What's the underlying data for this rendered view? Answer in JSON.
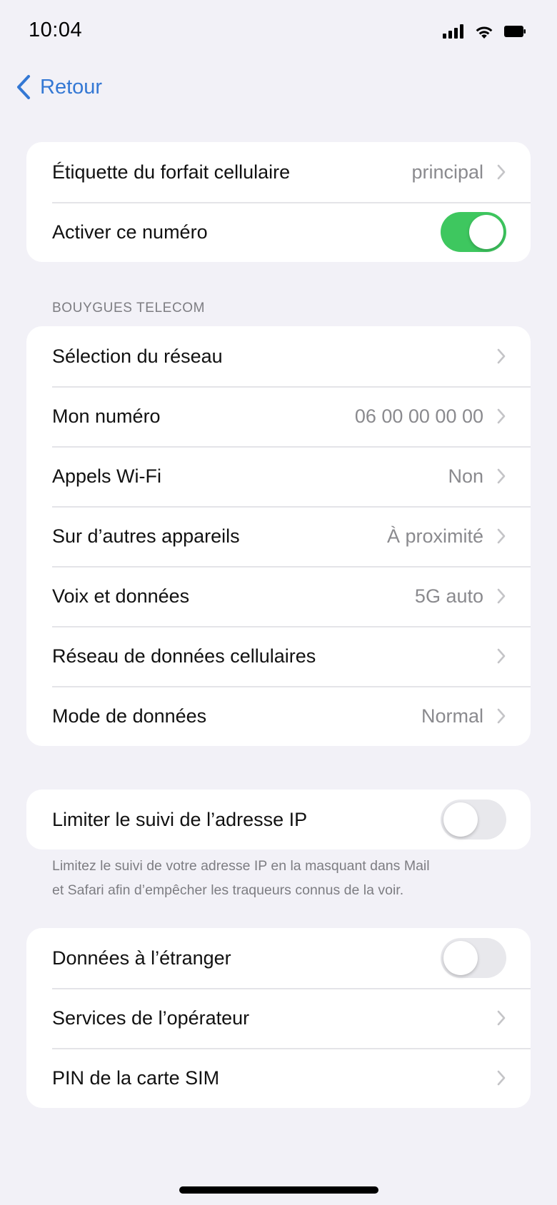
{
  "status": {
    "time": "10:04",
    "icons": [
      "signal-icon",
      "wifi-icon",
      "battery-icon"
    ]
  },
  "nav": {
    "back_label": "Retour"
  },
  "colors": {
    "accent": "#3478d4",
    "toggle_on": "#3ec75f",
    "toggle_off": "#e8e8ec",
    "background": "#f2f1f7"
  },
  "group1": {
    "plan_label": {
      "label": "Étiquette du forfait cellulaire",
      "value": "principal"
    },
    "activate": {
      "label": "Activer ce numéro",
      "toggle": "on"
    }
  },
  "section_header": "BOUYGUES TELECOM",
  "group2": {
    "rows": [
      {
        "label": "Sélection du réseau",
        "value": ""
      },
      {
        "label": "Mon numéro",
        "value": "06 00 00 00 00"
      },
      {
        "label": "Appels Wi-Fi",
        "value": "Non"
      },
      {
        "label": "Sur d’autres appareils",
        "value": "À proximité"
      },
      {
        "label": "Voix et données",
        "value": "5G auto"
      },
      {
        "label": "Réseau de données cellulaires",
        "value": ""
      },
      {
        "label": "Mode de données",
        "value": "Normal"
      }
    ]
  },
  "group3": {
    "limit_ip": {
      "label": "Limiter le suivi de l’adresse IP",
      "toggle": "off"
    },
    "footer_line1": "Limitez le suivi de votre adresse IP en la masquant dans Mail",
    "footer_line2": "et Safari afin d’empêcher les traqueurs connus de la voir."
  },
  "group4": {
    "roaming": {
      "label": "Données à l’étranger",
      "toggle": "off"
    },
    "rows": [
      {
        "label": "Services de l’opérateur"
      },
      {
        "label": "PIN de la carte SIM"
      }
    ]
  }
}
